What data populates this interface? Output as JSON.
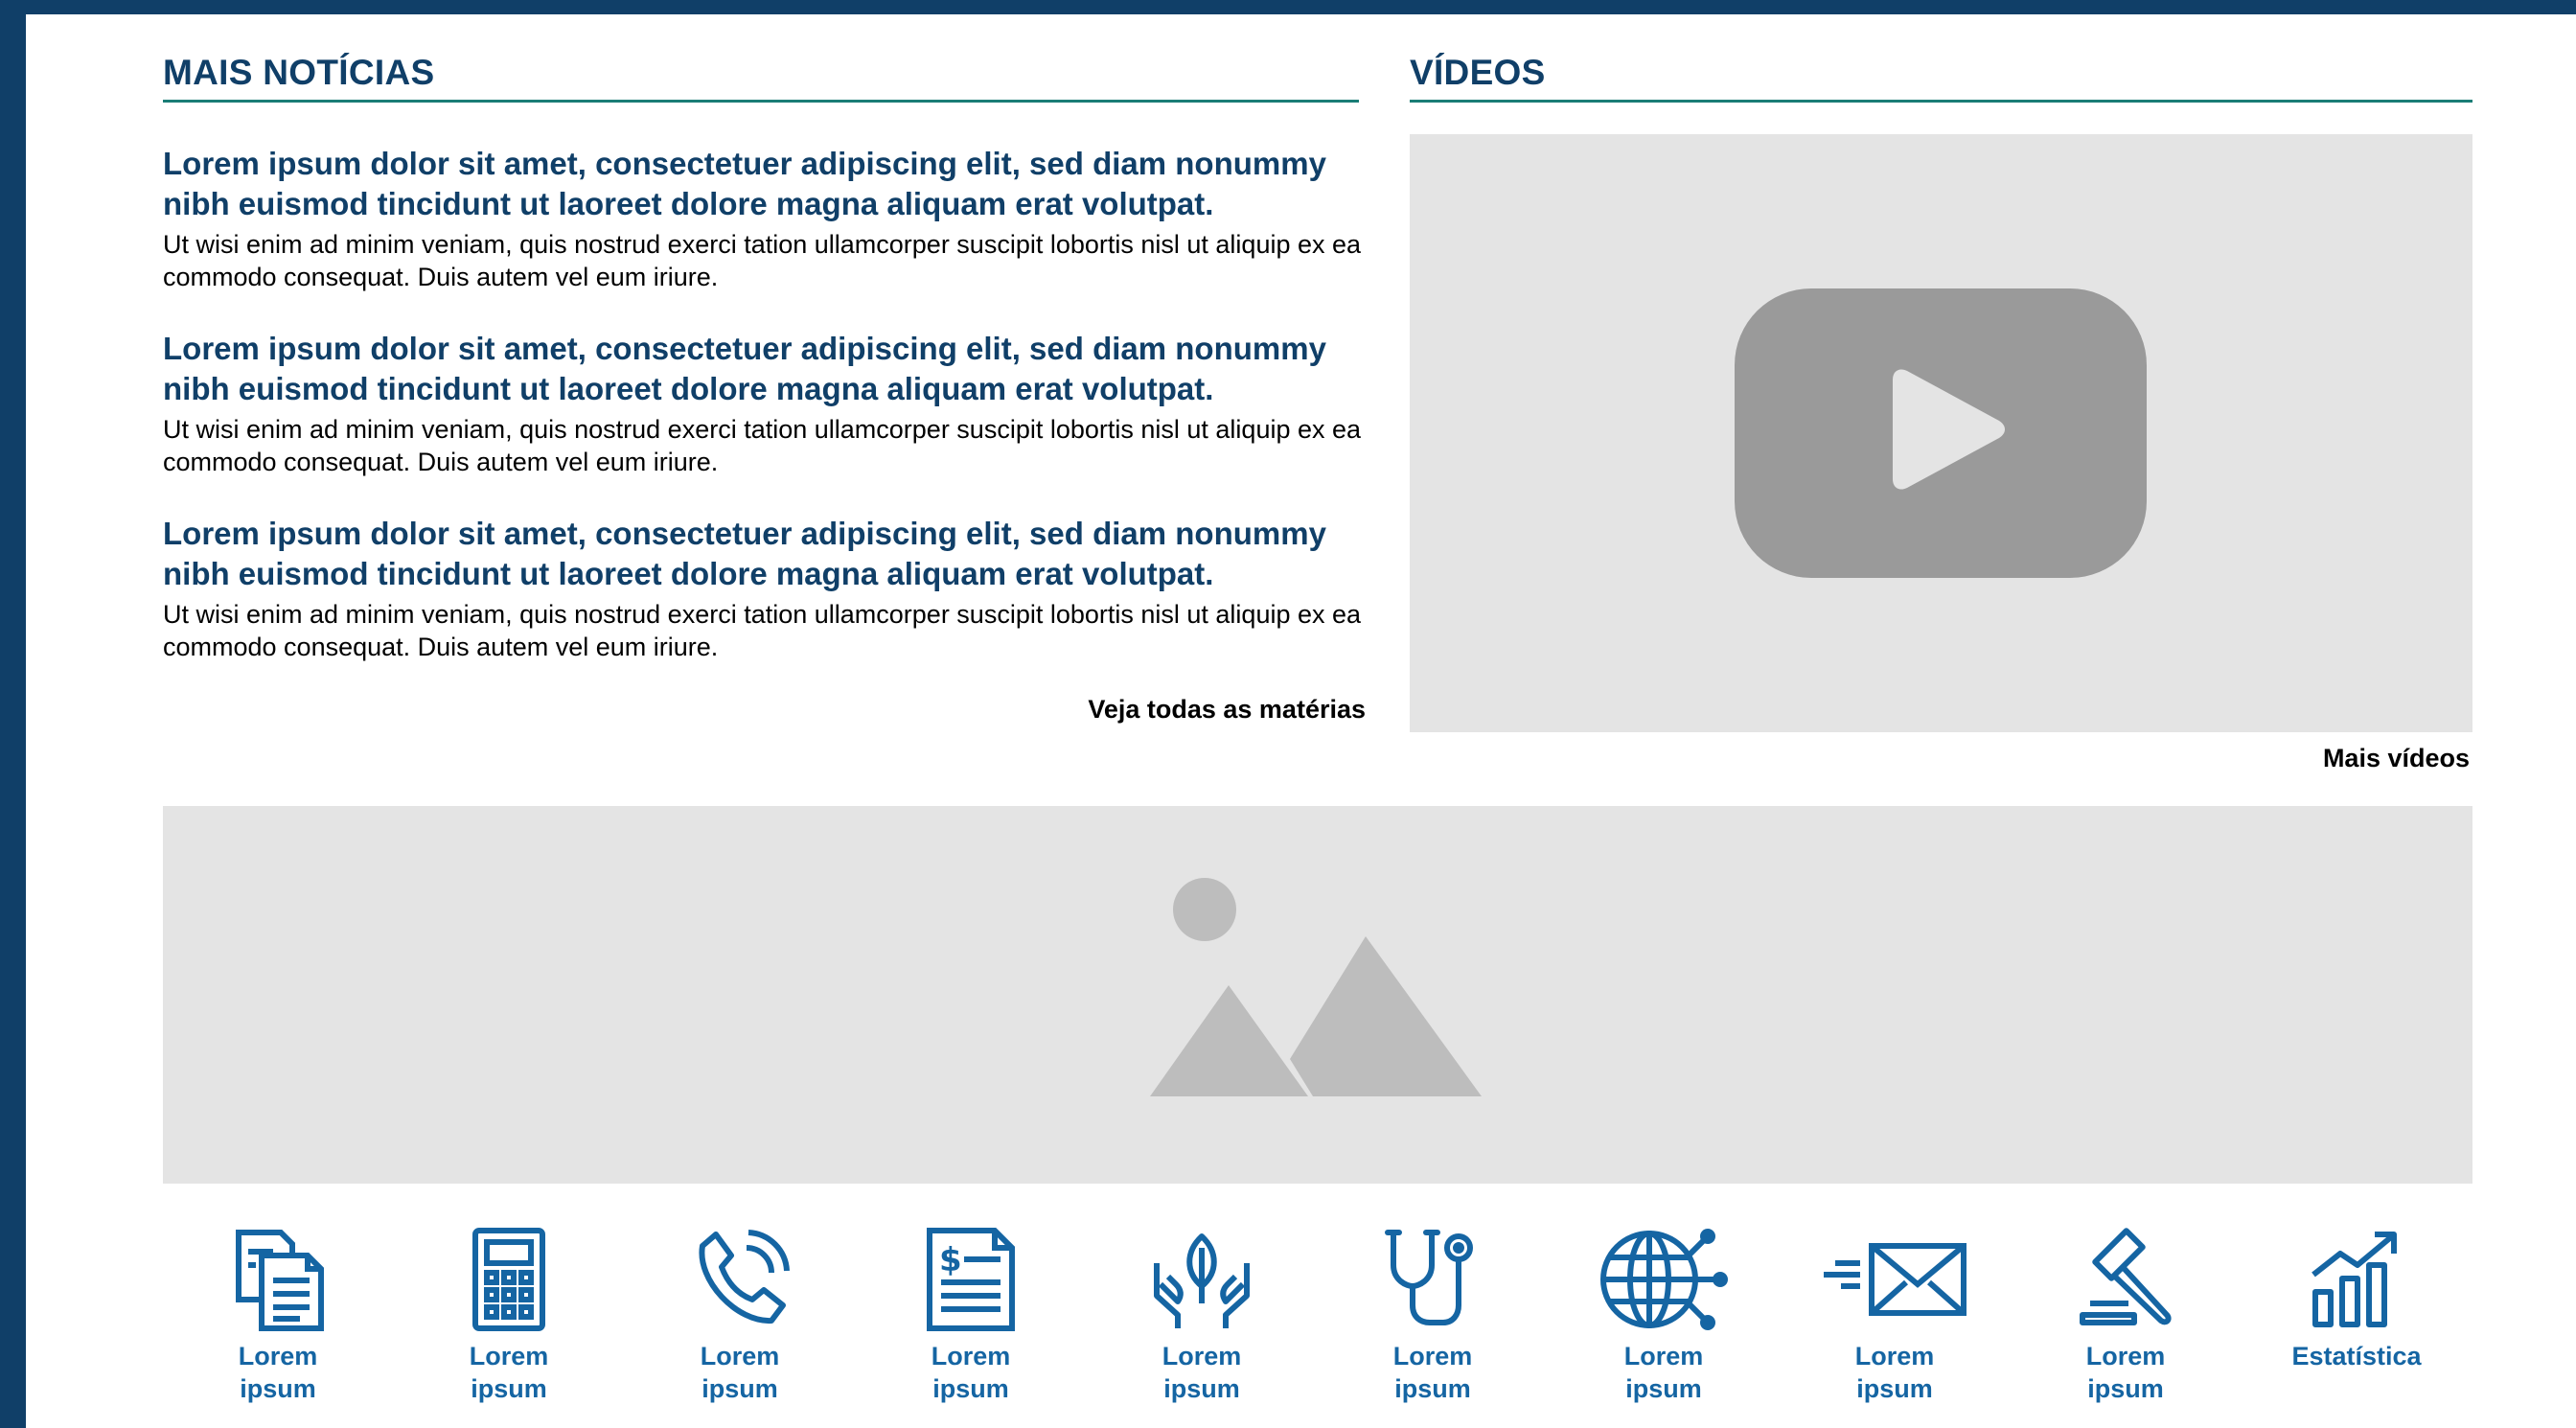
{
  "news_section": {
    "title": "MAIS NOTÍCIAS",
    "items": [
      {
        "headline": "Lorem ipsum dolor sit amet, consectetuer adipiscing elit, sed diam nonummy nibh euismod tincidunt ut laoreet dolore magna aliquam erat volutpat.",
        "summary": "Ut wisi enim ad minim veniam, quis nostrud exerci tation ullamcorper suscipit lobortis nisl ut aliquip ex ea commodo consequat. Duis autem vel eum iriure."
      },
      {
        "headline": "Lorem ipsum dolor sit amet, consectetuer adipiscing elit, sed diam nonummy nibh euismod tincidunt ut laoreet dolore magna aliquam erat volutpat.",
        "summary": "Ut wisi enim ad minim veniam, quis nostrud exerci tation ullamcorper suscipit lobortis nisl ut aliquip ex ea commodo consequat. Duis autem vel eum iriure."
      },
      {
        "headline": "Lorem ipsum dolor sit amet, consectetuer adipiscing elit, sed diam nonummy nibh euismod tincidunt ut laoreet dolore magna aliquam erat volutpat.",
        "summary": "Ut wisi enim ad minim veniam, quis nostrud exerci tation ullamcorper suscipit lobortis nisl ut aliquip ex ea commodo consequat. Duis autem vel eum iriure."
      }
    ],
    "more_link": "Veja todas as matérias"
  },
  "videos_section": {
    "title": "VÍDEOS",
    "more_link": "Mais vídeos"
  },
  "quick_links": [
    {
      "icon": "documents-icon",
      "label_line1": "Lorem",
      "label_line2": "ipsum"
    },
    {
      "icon": "calculator-icon",
      "label_line1": "Lorem",
      "label_line2": "ipsum"
    },
    {
      "icon": "phone-icon",
      "label_line1": "Lorem",
      "label_line2": "ipsum"
    },
    {
      "icon": "invoice-icon",
      "label_line1": "Lorem",
      "label_line2": "ipsum"
    },
    {
      "icon": "hands-leaf-icon",
      "label_line1": "Lorem",
      "label_line2": "ipsum"
    },
    {
      "icon": "stethoscope-icon",
      "label_line1": "Lorem",
      "label_line2": "ipsum"
    },
    {
      "icon": "globe-network-icon",
      "label_line1": "Lorem",
      "label_line2": "ipsum"
    },
    {
      "icon": "mail-send-icon",
      "label_line1": "Lorem",
      "label_line2": "ipsum"
    },
    {
      "icon": "gavel-icon",
      "label_line1": "Lorem",
      "label_line2": "ipsum"
    },
    {
      "icon": "chart-growth-icon",
      "label_line1": "Estatística",
      "label_line2": ""
    }
  ],
  "colors": {
    "frame": "#103f68",
    "heading": "#103f68",
    "rule": "#1a7d76",
    "icon": "#1565a3",
    "placeholder_bg": "#e4e4e4",
    "placeholder_fg": "#bdbdbd",
    "play_button": "#9a9a9a"
  }
}
